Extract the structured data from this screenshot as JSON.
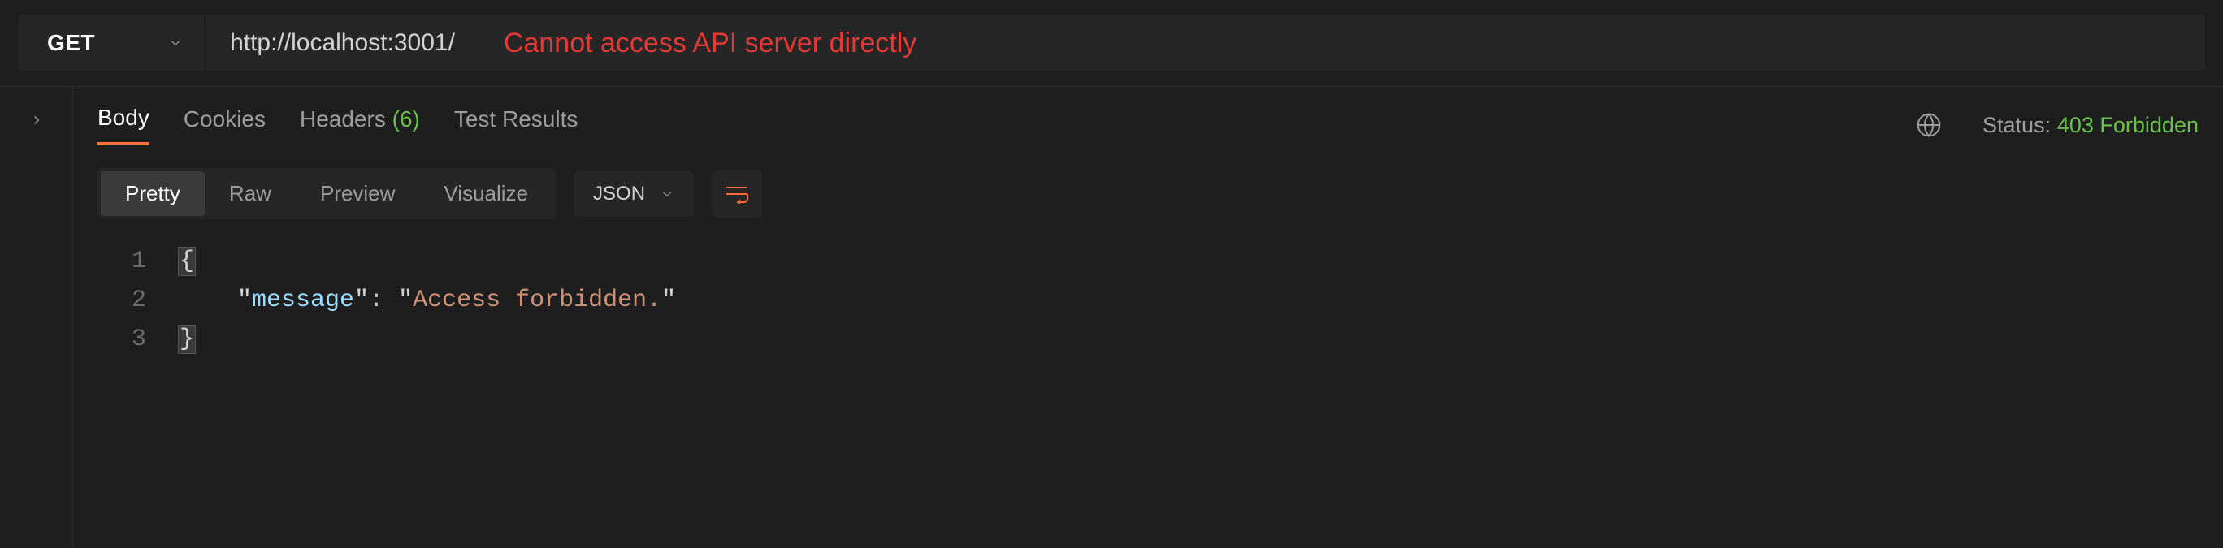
{
  "request": {
    "method": "GET",
    "url": "http://localhost:3001/",
    "annotation": "Cannot access API server directly"
  },
  "response": {
    "tabs": {
      "body": "Body",
      "cookies": "Cookies",
      "headers_label": "Headers",
      "headers_count": "(6)",
      "test_results": "Test Results"
    },
    "status_label": "Status:",
    "status_value": "403 Forbidden",
    "viewmodes": {
      "pretty": "Pretty",
      "raw": "Raw",
      "preview": "Preview",
      "visualize": "Visualize"
    },
    "format": "JSON",
    "body_lines": {
      "l1_num": "1",
      "l1_open": "{",
      "l2_num": "2",
      "l2_indent": "    ",
      "l2_key": "message",
      "l2_colon": ": ",
      "l2_val": "Access forbidden.",
      "l3_num": "3",
      "l3_close": "}"
    }
  }
}
